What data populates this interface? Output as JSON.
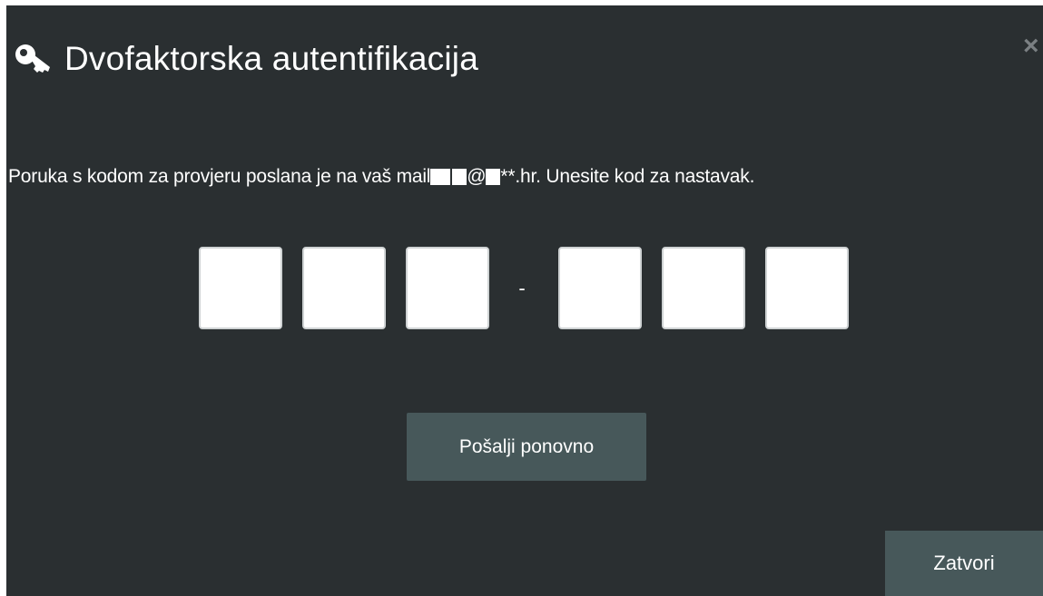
{
  "dialog": {
    "title": "Dvofaktorska autentifikacija",
    "close_glyph": "×",
    "title_icon": "key-icon",
    "close_icon": "close-icon"
  },
  "message": {
    "prefix": "Poruka s kodom za provjeru poslana je na vaš mail",
    "email_middle": "@",
    "email_suffix": "**.hr. Unesite kod za nastavak."
  },
  "code": {
    "digits": [
      "",
      "",
      "",
      "",
      "",
      ""
    ],
    "separator": "-"
  },
  "buttons": {
    "resend_label": "Pošalji ponovno",
    "close_label": "Zatvori"
  },
  "colors": {
    "background": "#2a2f31",
    "button": "#47585a",
    "close_icon": "#7b8083"
  }
}
